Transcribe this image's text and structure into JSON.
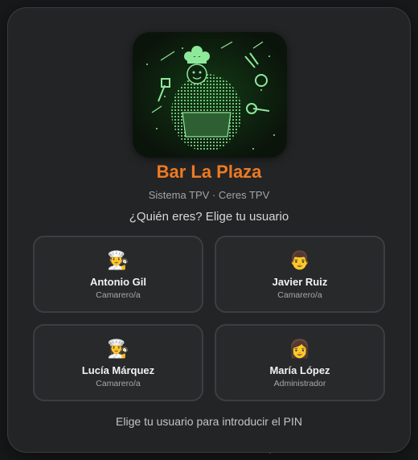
{
  "app": {
    "title": "Bar La Plaza",
    "subtitle": "Sistema TPV · Ceres TPV",
    "prompt": "¿Quién eres? Elige tu usuario",
    "footer": "Elige tu usuario para introducir el PIN",
    "accent_color": "#ee7a22",
    "logo_icon": "chef-logo-icon"
  },
  "users": [
    {
      "name": "Antonio Gil",
      "role": "Camarero/a",
      "avatar": "🧑‍🍳"
    },
    {
      "name": "Javier Ruiz",
      "role": "Camarero/a",
      "avatar": "👨"
    },
    {
      "name": "Lucía Márquez",
      "role": "Camarero/a",
      "avatar": "👩‍🍳"
    },
    {
      "name": "María López",
      "role": "Administrador",
      "avatar": "👩"
    }
  ]
}
